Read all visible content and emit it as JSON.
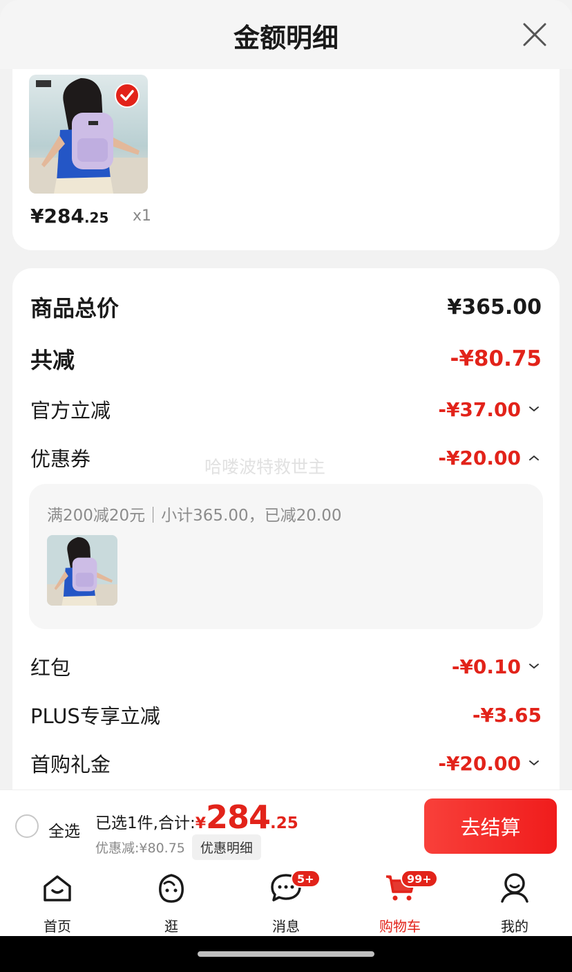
{
  "header": {
    "title": "金额明细"
  },
  "product": {
    "price_int": "¥284",
    "price_dec": ".25",
    "qty": "x1"
  },
  "summary": {
    "total_label": "商品总价",
    "total_value": "¥365.00",
    "reduce_label": "共减",
    "reduce_value": "-¥80.75",
    "items": [
      {
        "label": "官方立减",
        "value": "-¥37.00"
      },
      {
        "label": "优惠券",
        "value": "-¥20.00"
      },
      {
        "label": "红包",
        "value": "-¥0.10"
      },
      {
        "label": "PLUS专享立减",
        "value": "-¥3.65"
      },
      {
        "label": "首购礼金",
        "value": "-¥20.00"
      }
    ],
    "coupon_detail": "满200减20元｜小计365.00，已减20.00"
  },
  "watermark": "哈喽波特救世主",
  "bottom": {
    "select_all": "全选",
    "selected_label": "已选1件,合计:",
    "total_yen": "¥",
    "total_int": "284",
    "total_dec": ".25",
    "discount_text": "优惠减:¥80.75",
    "discount_btn": "优惠明细",
    "checkout": "去结算"
  },
  "tabs": [
    {
      "label": "首页"
    },
    {
      "label": "逛"
    },
    {
      "label": "消息",
      "badge": "5+"
    },
    {
      "label": "购物车",
      "badge": "99+"
    },
    {
      "label": "我的"
    }
  ],
  "colors": {
    "accent": "#e2231a",
    "background": "#f2f2f2"
  }
}
